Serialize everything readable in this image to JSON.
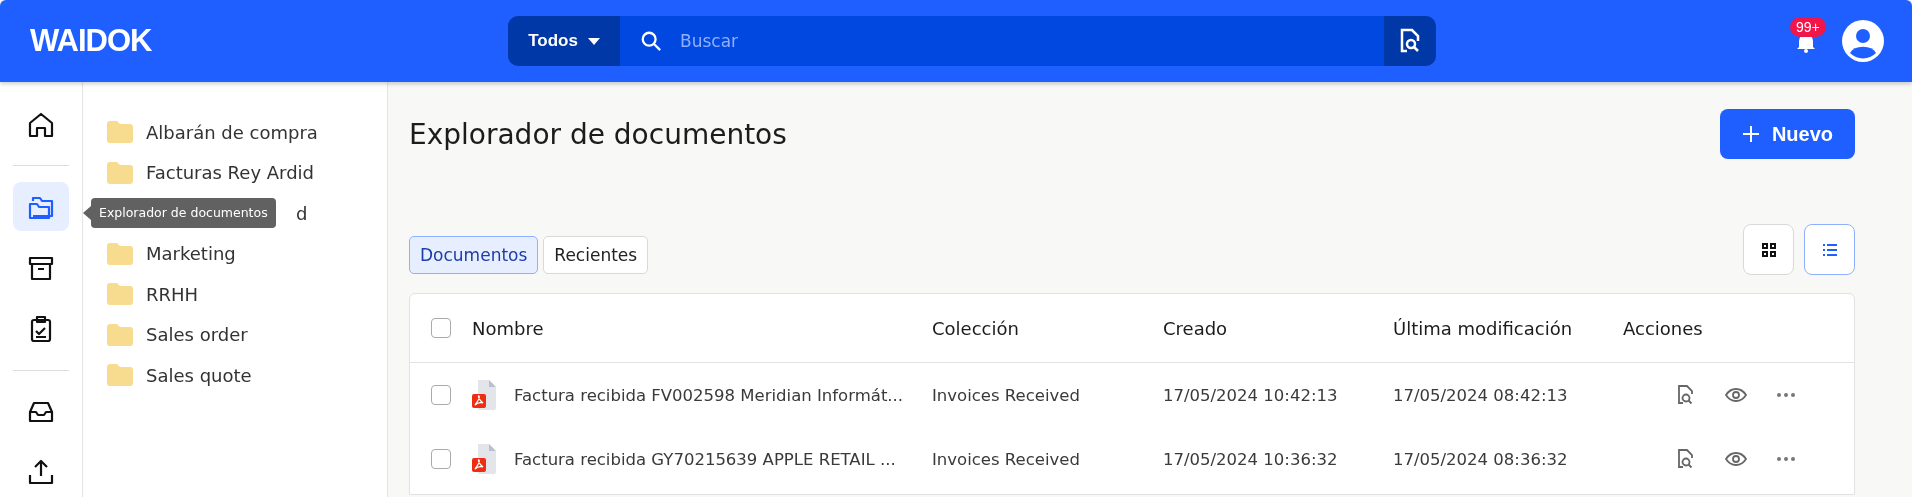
{
  "header": {
    "logo": "WAIDOK",
    "scope": "Todos",
    "search": {
      "placeholder": "Buscar"
    },
    "notifications": "99+"
  },
  "rail": [
    {
      "kind": "home",
      "selected": false
    },
    {
      "kind": "divider"
    },
    {
      "kind": "folders",
      "selected": true
    },
    {
      "kind": "archive",
      "selected": false
    },
    {
      "kind": "tasks",
      "selected": false
    },
    {
      "kind": "divider"
    },
    {
      "kind": "inbox",
      "selected": false
    },
    {
      "kind": "upload",
      "selected": false
    }
  ],
  "tooltip": "Explorador de documentos",
  "folders": [
    {
      "label": "Albarán de compra",
      "covered": false
    },
    {
      "label": "Facturas Rey Ardid",
      "covered": false
    },
    {
      "label": "d",
      "covered": true
    },
    {
      "label": "Marketing",
      "covered": false
    },
    {
      "label": "RRHH",
      "covered": false
    },
    {
      "label": "Sales order",
      "covered": false
    },
    {
      "label": "Sales quote",
      "covered": false
    }
  ],
  "title": "Explorador de documentos",
  "new_button": "Nuevo",
  "tabs": [
    {
      "label": "Documentos",
      "selected": true
    },
    {
      "label": "Recientes",
      "selected": false
    }
  ],
  "views": [
    {
      "kind": "grid",
      "selected": false
    },
    {
      "kind": "list",
      "selected": true
    }
  ],
  "table": {
    "columns": [
      "Nombre",
      "Colección",
      "Creado",
      "Última modificación",
      "Acciones"
    ],
    "all_checked": false,
    "rows": [
      {
        "checked": false,
        "name": "Factura recibida FV002598 Meridian Informát...",
        "collection": "Invoices Received",
        "created": "17/05/2024 10:42:13",
        "modified": "17/05/2024 08:42:13"
      },
      {
        "checked": false,
        "name": "Factura recibida GY70215639 APPLE RETAIL ...",
        "collection": "Invoices Received",
        "created": "17/05/2024 10:36:32",
        "modified": "17/05/2024 08:36:32"
      }
    ]
  }
}
